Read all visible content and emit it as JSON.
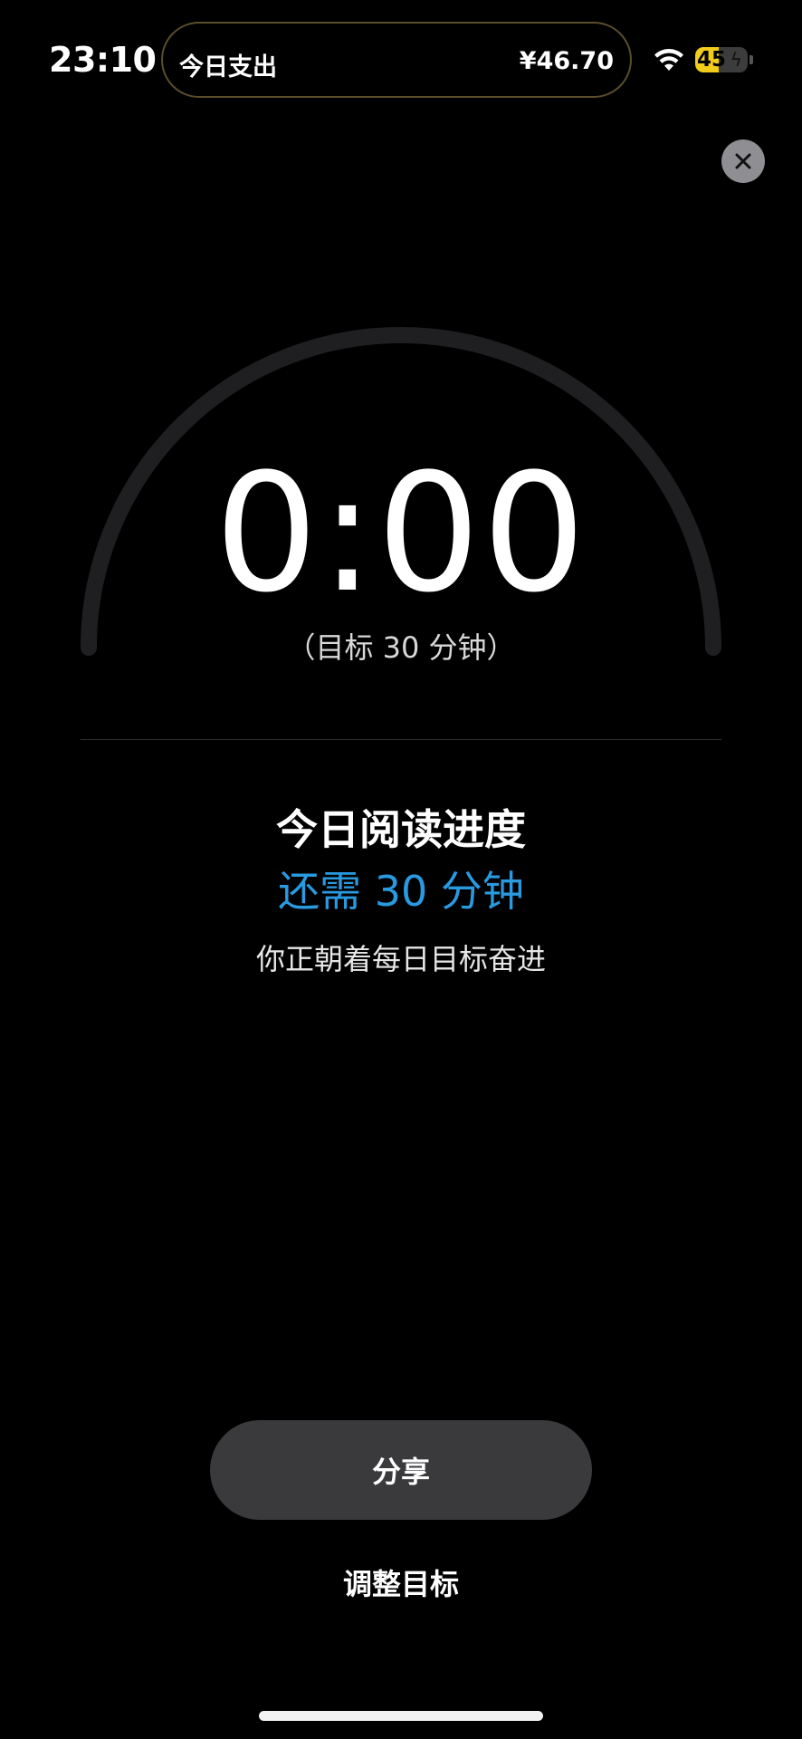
{
  "status_bar": {
    "time": "23:10",
    "island_label": "今日支出",
    "island_amount": "¥46.70",
    "battery_level": "45",
    "battery_fraction": 0.45,
    "charging": true,
    "wifi_icon": "wifi-icon",
    "battery_icon": "battery-charging-icon"
  },
  "close_button": {
    "icon": "close-icon"
  },
  "timer": {
    "elapsed": "0:00",
    "target_label": "（目标 30 分钟）",
    "progress_fraction": 0.0
  },
  "progress": {
    "title": "今日阅读进度",
    "remaining": "还需 30 分钟",
    "message": "你正朝着每日目标奋进"
  },
  "actions": {
    "share_label": "分享",
    "adjust_label": "调整目标"
  },
  "colors": {
    "background": "#000000",
    "accent_blue": "#2a9ae0",
    "battery_yellow": "#f2cc1a",
    "arc_track": "#1f1f21",
    "button_bg": "#3a3a3c"
  }
}
